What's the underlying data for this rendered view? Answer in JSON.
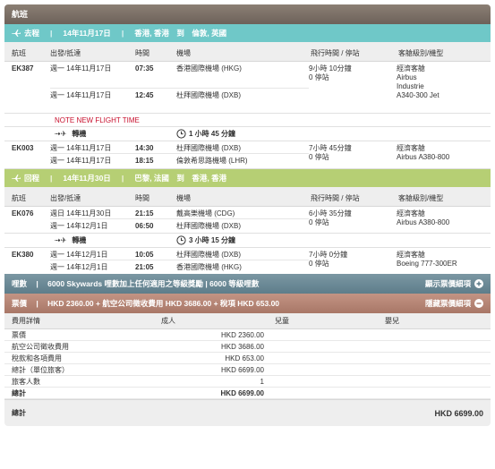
{
  "section_title": "航班",
  "outbound": {
    "label": "去程",
    "date": "14年11月17日",
    "route": "香港, 香港　到　倫敦, 英國"
  },
  "return": {
    "label": "回程",
    "date": "14年11月30日",
    "route": "巴黎, 法國　到　香港, 香港"
  },
  "headers": {
    "flight": "航班",
    "depart_arrive": "出發/抵達",
    "time": "時間",
    "airport": "機場",
    "duration_stops": "飛行時間 / 停站",
    "cabin_aircraft": "客艙級別/機型"
  },
  "flights": {
    "ek387": {
      "code": "EK387",
      "dep_date": "週一 14年11月17日",
      "dep_time": "07:35",
      "dep_airport": "香港國際機場 (HKG)",
      "arr_date": "週一 14年11月17日",
      "arr_time": "12:45",
      "arr_airport": "杜拜國際機場 (DXB)",
      "duration": "9小時 10分鐘",
      "stops": "0 停站",
      "cabin": "經濟客艙",
      "aircraft": "Airbus Industrie A340-300 Jet",
      "notice": "NOTE NEW FLIGHT TIME"
    },
    "transfer1": {
      "label": "轉機",
      "duration": "1 小時 45 分鐘"
    },
    "ek003": {
      "code": "EK003",
      "dep_date": "週一 14年11月17日",
      "dep_time": "14:30",
      "dep_airport": "杜拜國際機場 (DXB)",
      "arr_date": "週一 14年11月17日",
      "arr_time": "18:15",
      "arr_airport": "倫敦希思路機場 (LHR)",
      "duration": "7小時 45分鐘",
      "stops": "0 停站",
      "cabin": "經濟客艙",
      "aircraft": "Airbus A380-800"
    },
    "ek076": {
      "code": "EK076",
      "dep_date": "週日 14年11月30日",
      "dep_time": "21:15",
      "dep_airport": "戴高樂機場 (CDG)",
      "arr_date": "週一 14年12月1日",
      "arr_time": "06:50",
      "arr_airport": "杜拜國際機場 (DXB)",
      "duration": "6小時 35分鐘",
      "stops": "0 停站",
      "cabin": "經濟客艙",
      "aircraft": "Airbus A380-800"
    },
    "transfer2": {
      "label": "轉機",
      "duration": "3 小時 15 分鐘"
    },
    "ek380": {
      "code": "EK380",
      "dep_date": "週一 14年12月1日",
      "dep_time": "10:05",
      "dep_airport": "杜拜國際機場 (DXB)",
      "arr_date": "週一 14年12月1日",
      "arr_time": "21:05",
      "arr_airport": "香港國際機場 (HKG)",
      "duration": "7小時 0分鐘",
      "stops": "0 停站",
      "cabin": "經濟客艙",
      "aircraft": "Boeing 777-300ER"
    }
  },
  "miles": {
    "label": "哩數",
    "text": "6000 Skywards 哩數加上任何適用之等級獎勵 | 6000 等級哩數",
    "link": "顯示票價細項"
  },
  "fare": {
    "label": "票價",
    "summary": "HKD 2360.00 + 航空公司徵收費用 HKD 3686.00 + 稅項 HKD 653.00",
    "link": "隱藏票價細項",
    "headers": {
      "details": "費用詳情",
      "adult": "成人",
      "child": "兒童",
      "infant": "嬰兒"
    },
    "rows": [
      {
        "label": "票價",
        "adult": "HKD 2360.00"
      },
      {
        "label": "航空公司徵收費用",
        "adult": "HKD 3686.00"
      },
      {
        "label": "稅款和各項費用",
        "adult": "HKD 653.00"
      },
      {
        "label": "總計（單位旅客）",
        "adult": "HKD 6699.00"
      },
      {
        "label": "旅客人數",
        "adult": "1"
      },
      {
        "label": "總計",
        "adult": "HKD 6699.00"
      }
    ],
    "grand_total_label": "總計",
    "grand_total": "HKD 6699.00"
  },
  "colors": {
    "outbound_band": "#6fc8c8",
    "return_band": "#b6cf74",
    "miles_band": "#6a8a97",
    "fare_band": "#b5826f",
    "notice": "#c8102e"
  }
}
